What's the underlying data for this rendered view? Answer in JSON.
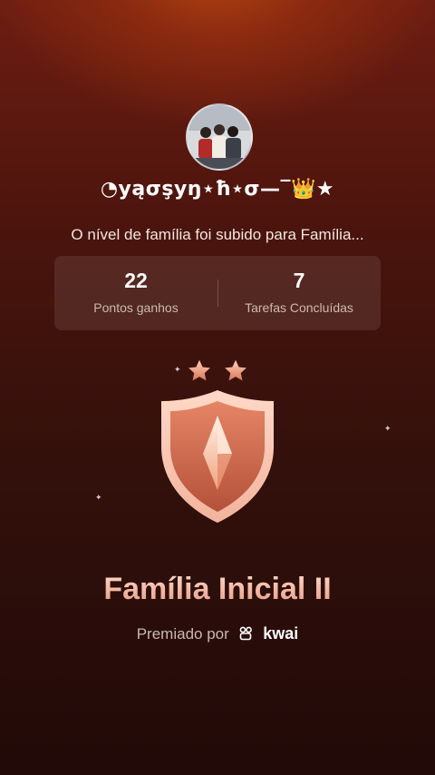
{
  "profile": {
    "username": "◔уąσşуŋ⋆ħ⋆σ—‾👑★",
    "level_message": "O nível de família foi subido para Família..."
  },
  "stats": {
    "points_value": "22",
    "points_label": "Pontos ganhos",
    "tasks_value": "7",
    "tasks_label": "Tarefas Concluídas"
  },
  "badge": {
    "title": "Família Inicial II",
    "stars": 2,
    "awarded_by_label": "Premiado por",
    "brand": "kwai"
  },
  "colors": {
    "background_top": "#b8450f",
    "background_bottom": "#210a08",
    "badge_title": "#f4b8a5",
    "star": "#e8967a"
  }
}
